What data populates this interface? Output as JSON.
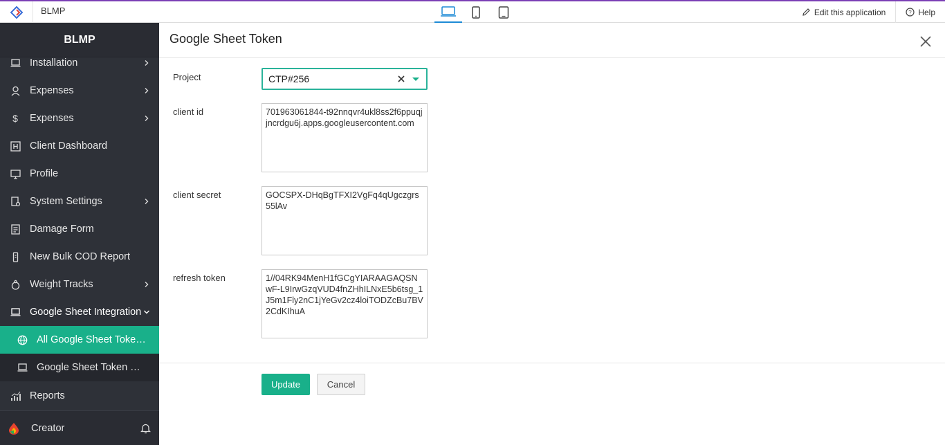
{
  "app": {
    "name": "BLMP"
  },
  "topbar": {
    "devices": [
      "desktop-icon",
      "mobile-icon",
      "tablet-icon"
    ],
    "edit_label": "Edit this application",
    "help_label": "Help"
  },
  "sidebar": {
    "title": "BLMP",
    "items": [
      {
        "label": "Installation",
        "icon": "installation-icon",
        "chevron": true
      },
      {
        "label": "Expenses",
        "icon": "expenses-icon",
        "chevron": true
      },
      {
        "label": "Expenses",
        "icon": "dollar-icon",
        "chevron": true
      },
      {
        "label": "Client Dashboard",
        "icon": "dashboard-icon",
        "chevron": false
      },
      {
        "label": "Profile",
        "icon": "monitor-icon",
        "chevron": false
      },
      {
        "label": "System Settings",
        "icon": "settings-doc-icon",
        "chevron": true
      },
      {
        "label": "Damage Form",
        "icon": "form-icon",
        "chevron": false
      },
      {
        "label": "New Bulk COD Report",
        "icon": "report-icon",
        "chevron": false
      },
      {
        "label": "Weight Tracks",
        "icon": "weight-icon",
        "chevron": true
      },
      {
        "label": "Google Sheet Integration",
        "icon": "laptop-icon",
        "chevron": "open"
      },
      {
        "label": "All Google Sheet Token...",
        "icon": "globe-icon",
        "sub": true,
        "active": true
      },
      {
        "label": "Google Sheet Token Ge...",
        "icon": "laptop-icon",
        "sub": true
      },
      {
        "label": "Reports",
        "icon": "chart-icon",
        "chevron": false
      }
    ],
    "footer_label": "Creator"
  },
  "form": {
    "title": "Google Sheet Token",
    "project_label": "Project",
    "project_value": "CTP#256",
    "client_id_label": "client id",
    "client_id_value": "701963061844-t92nnqvr4ukl8ss2f6ppuqjjncrdgu6j.apps.googleusercontent.com",
    "client_secret_label": "client secret",
    "client_secret_value": "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",
    "refresh_token_label": "refresh token",
    "refresh_token_value": "1//04RK94MenH1fGCgYIARAAGAQSNwF-L9IrwGzqVUD4fnZHhILNxE5b6tsg_1J5m1Fly2nC1jYeGv2cz4loiTODZcBu7BV2CdKIhuA",
    "update_label": "Update",
    "cancel_label": "Cancel"
  },
  "colors": {
    "accent": "#19b08a",
    "sidebar_bg": "#2e3138",
    "topbar_border": "#7b3fb5"
  }
}
